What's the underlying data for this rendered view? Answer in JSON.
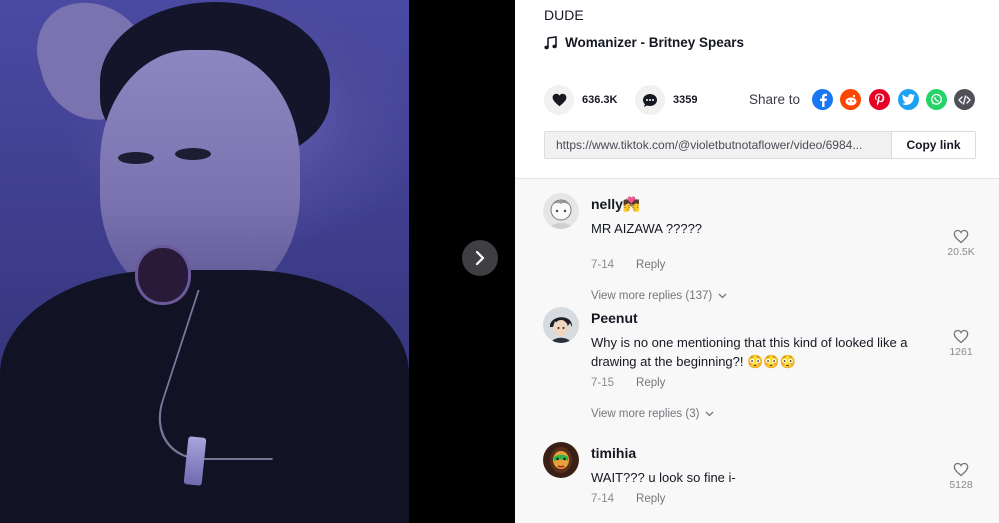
{
  "video": {
    "next_icon": "chevron-right-icon"
  },
  "post": {
    "caption": "DUDE",
    "music": "Womanizer - Britney Spears",
    "music_icon": "music-note-icon"
  },
  "actions": {
    "likes": "636.3K",
    "comments": "3359"
  },
  "share": {
    "label": "Share to",
    "targets": [
      {
        "name": "facebook",
        "color": "#1877F2"
      },
      {
        "name": "reddit",
        "color": "#FF4500"
      },
      {
        "name": "pinterest",
        "color": "#E60023"
      },
      {
        "name": "twitter",
        "color": "#1DA1F2"
      },
      {
        "name": "whatsapp",
        "color": "#25D366"
      },
      {
        "name": "embed",
        "color": "#505158"
      }
    ]
  },
  "link": {
    "url": "https://www.tiktok.com/@violetbutnotaflower/video/6984...",
    "copy_label": "Copy link"
  },
  "comments": [
    {
      "user": "nelly",
      "user_emoji": "💏",
      "text": "MR AIZAWA ?????",
      "date": "7-14",
      "reply_label": "Reply",
      "likes": "20.5K",
      "view_more": "View more replies (137)"
    },
    {
      "user": "Peenut",
      "user_emoji": "",
      "text": "Why is no one mentioning that this kind of looked like a drawing at the beginning?! 😳😳😳",
      "date": "7-15",
      "reply_label": "Reply",
      "likes": "1261",
      "view_more": "View more replies (3)"
    },
    {
      "user": "timihia",
      "user_emoji": "",
      "text": "WAIT??? u look so fine i-",
      "date": "7-14",
      "reply_label": "Reply",
      "likes": "5128",
      "view_more": ""
    }
  ]
}
